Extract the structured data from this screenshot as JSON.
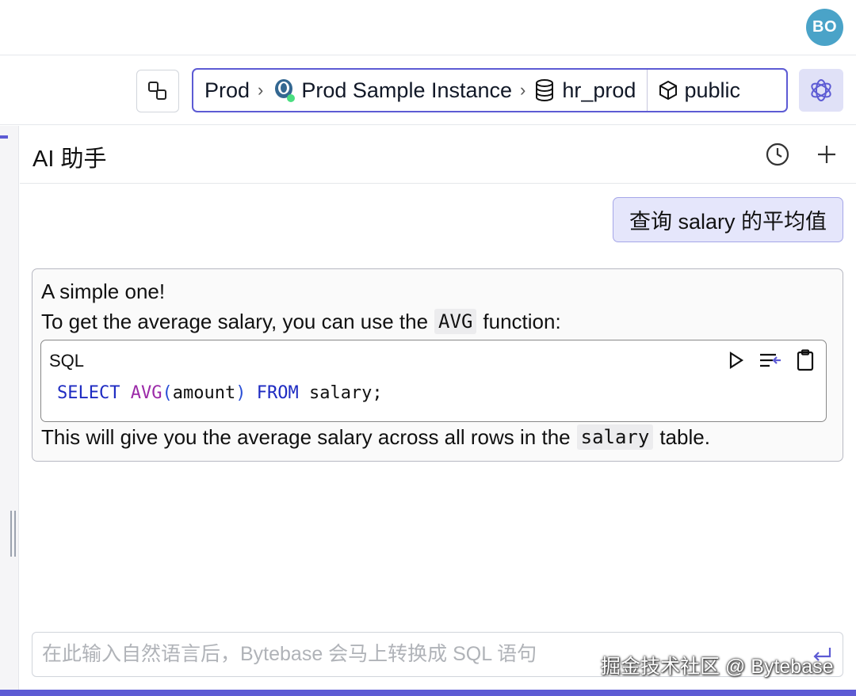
{
  "user": {
    "avatar_initials": "BO",
    "avatar_color": "#4aa3c8"
  },
  "context": {
    "environment": "Prod",
    "instance": "Prod Sample Instance",
    "database": "hr_prod",
    "schema": "public"
  },
  "panel": {
    "title": "AI 助手"
  },
  "chat": {
    "user_message": "查询 salary 的平均值",
    "ai_line1": "A simple one!",
    "ai_line2_before": "To get the average salary, you can use the",
    "ai_line2_code": "AVG",
    "ai_line2_after": "function:",
    "code_language": "SQL",
    "code": {
      "kw_select": "SELECT",
      "fn_avg": "AVG",
      "paren_open": "(",
      "arg": "amount",
      "paren_close": ")",
      "kw_from": "FROM",
      "table": "salary;"
    },
    "ai_line3_before": "This will give you the average salary across all rows in the",
    "ai_line3_code": "salary",
    "ai_line3_after": "table."
  },
  "input": {
    "placeholder": "在此输入自然语言后，Bytebase 会马上转换成 SQL 语句"
  },
  "watermark": "掘金技术社区 @ Bytebase",
  "colors": {
    "accent": "#5d5bd4",
    "user_bubble": "#e5e6fb",
    "sql_keyword": "#1e2bc2",
    "sql_function": "#9b2aa8"
  }
}
